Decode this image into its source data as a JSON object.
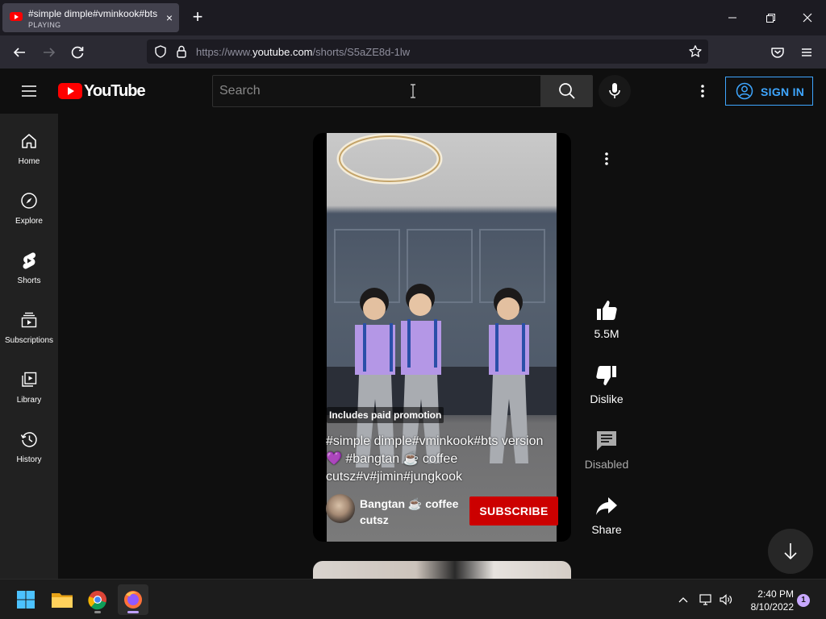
{
  "browser": {
    "tab": {
      "title": "#simple dimple#vminkook#bts version",
      "status": "PLAYING",
      "close_symbol": "×"
    },
    "new_tab_symbol": "+",
    "url": {
      "prefix": "https://www.",
      "domain": "youtube.com",
      "path": "/shorts/S5aZE8d-1lw"
    }
  },
  "youtube": {
    "logo_text": "YouTube",
    "search": {
      "placeholder": "Search",
      "value": ""
    },
    "sign_in_label": "SIGN IN",
    "sidebar": [
      {
        "label": "Home",
        "icon": "home-icon"
      },
      {
        "label": "Explore",
        "icon": "compass-icon"
      },
      {
        "label": "Shorts",
        "icon": "shorts-icon"
      },
      {
        "label": "Subscriptions",
        "icon": "subscriptions-icon"
      },
      {
        "label": "Library",
        "icon": "library-icon"
      },
      {
        "label": "History",
        "icon": "history-icon"
      }
    ],
    "short": {
      "promo_label": "Includes paid promotion",
      "caption": "#simple dimple#vminkook#bts version 💜 #bangtan ☕ coffee cutsz#v#jimin#jungkook",
      "channel_name": "Bangtan ☕ coffee cutsz",
      "subscribe_label": "SUBSCRIBE"
    },
    "actions": {
      "like_count": "5.5M",
      "dislike_label": "Dislike",
      "comments_label": "Disabled",
      "share_label": "Share"
    },
    "colors": {
      "brand_red": "#ff0000",
      "subscribe_red": "#cc0000",
      "link_blue": "#3ea6ff"
    }
  },
  "taskbar": {
    "apps": [
      "start-icon",
      "file-explorer-icon",
      "chrome-icon",
      "firefox-icon"
    ],
    "time": "2:40 PM",
    "date": "8/10/2022",
    "notification_count": "1"
  }
}
